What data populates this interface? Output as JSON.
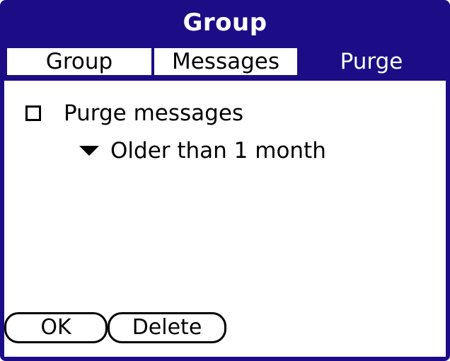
{
  "window": {
    "title": "Group"
  },
  "tabs": [
    {
      "label": "Group",
      "active": false
    },
    {
      "label": "Messages",
      "active": false
    },
    {
      "label": "Purge",
      "active": true
    }
  ],
  "purge": {
    "checkbox_label": "Purge messages",
    "checked": false,
    "dropdown_value": "Older than 1 month"
  },
  "buttons": {
    "ok_label": "OK",
    "delete_label": "Delete"
  },
  "colors": {
    "accent": "#1c0d86",
    "background": "#ffffff",
    "text": "#000000"
  },
  "icons": {
    "dropdown": "triangle-down-icon",
    "checkbox": "checkbox-unchecked-icon"
  }
}
